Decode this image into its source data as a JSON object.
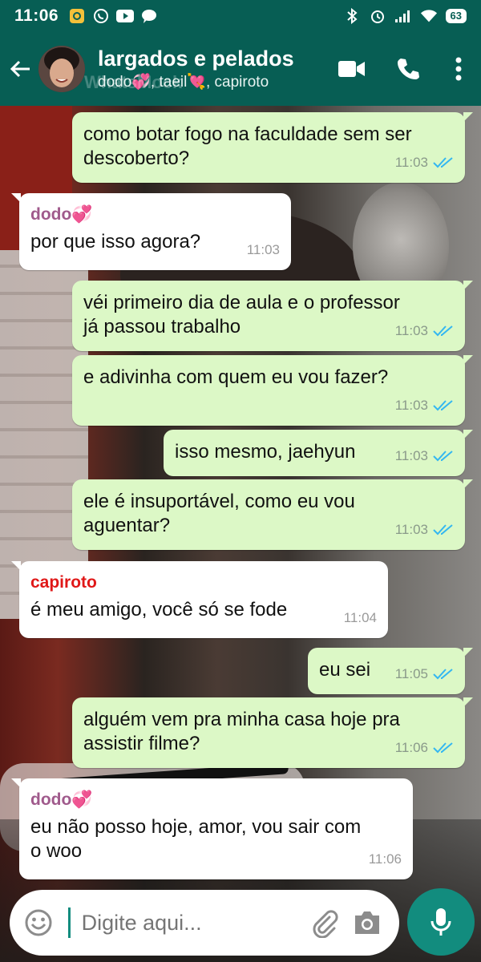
{
  "status_bar": {
    "time": "11:06",
    "battery": "63"
  },
  "header": {
    "title": "largados e pelados",
    "subtitle": "dodo💞, taeil💘, capiroto",
    "watermark": "WhatsMock"
  },
  "colors": {
    "header": "#075e54",
    "outgoing_bubble": "#dcf8c6",
    "incoming_bubble": "#ffffff",
    "sender_dodo": "#a05a8c",
    "sender_capiroto": "#e01818",
    "read_ticks": "#34b7f1",
    "accent": "#128c7e"
  },
  "messages": [
    {
      "dir": "out",
      "text": "como botar fogo na faculdade sem ser\ndescoberto?",
      "time": "11:03"
    },
    {
      "dir": "in",
      "sender": "dodo💞",
      "text": "por que isso agora?",
      "time": "11:03"
    },
    {
      "dir": "out",
      "text": "véi primeiro dia de aula e o professor\njá passou trabalho",
      "time": "11:03"
    },
    {
      "dir": "out",
      "text": "e adivinha com quem eu vou fazer?",
      "time": "11:03"
    },
    {
      "dir": "out",
      "text": "isso mesmo, jaehyun",
      "time": "11:03"
    },
    {
      "dir": "out",
      "text": "ele é insuportável, como eu vou\naguentar?",
      "time": "11:03"
    },
    {
      "dir": "in",
      "sender": "capiroto",
      "text": "é meu amigo, você só se fode",
      "time": "11:04"
    },
    {
      "dir": "out",
      "text": "eu sei",
      "time": "11:05"
    },
    {
      "dir": "out",
      "text": "alguém vem pra minha casa hoje pra\nassistir filme?",
      "time": "11:06"
    },
    {
      "dir": "in",
      "sender": "dodo💞",
      "text": "eu não posso hoje, amor, vou sair com\no woo",
      "time": "11:06"
    }
  ],
  "input": {
    "placeholder": "Digite aqui..."
  },
  "icons": [
    "back-arrow-icon",
    "video-call-icon",
    "phone-icon",
    "more-vert-icon",
    "emoji-icon",
    "attach-icon",
    "camera-icon",
    "mic-icon",
    "double-check-icon"
  ]
}
